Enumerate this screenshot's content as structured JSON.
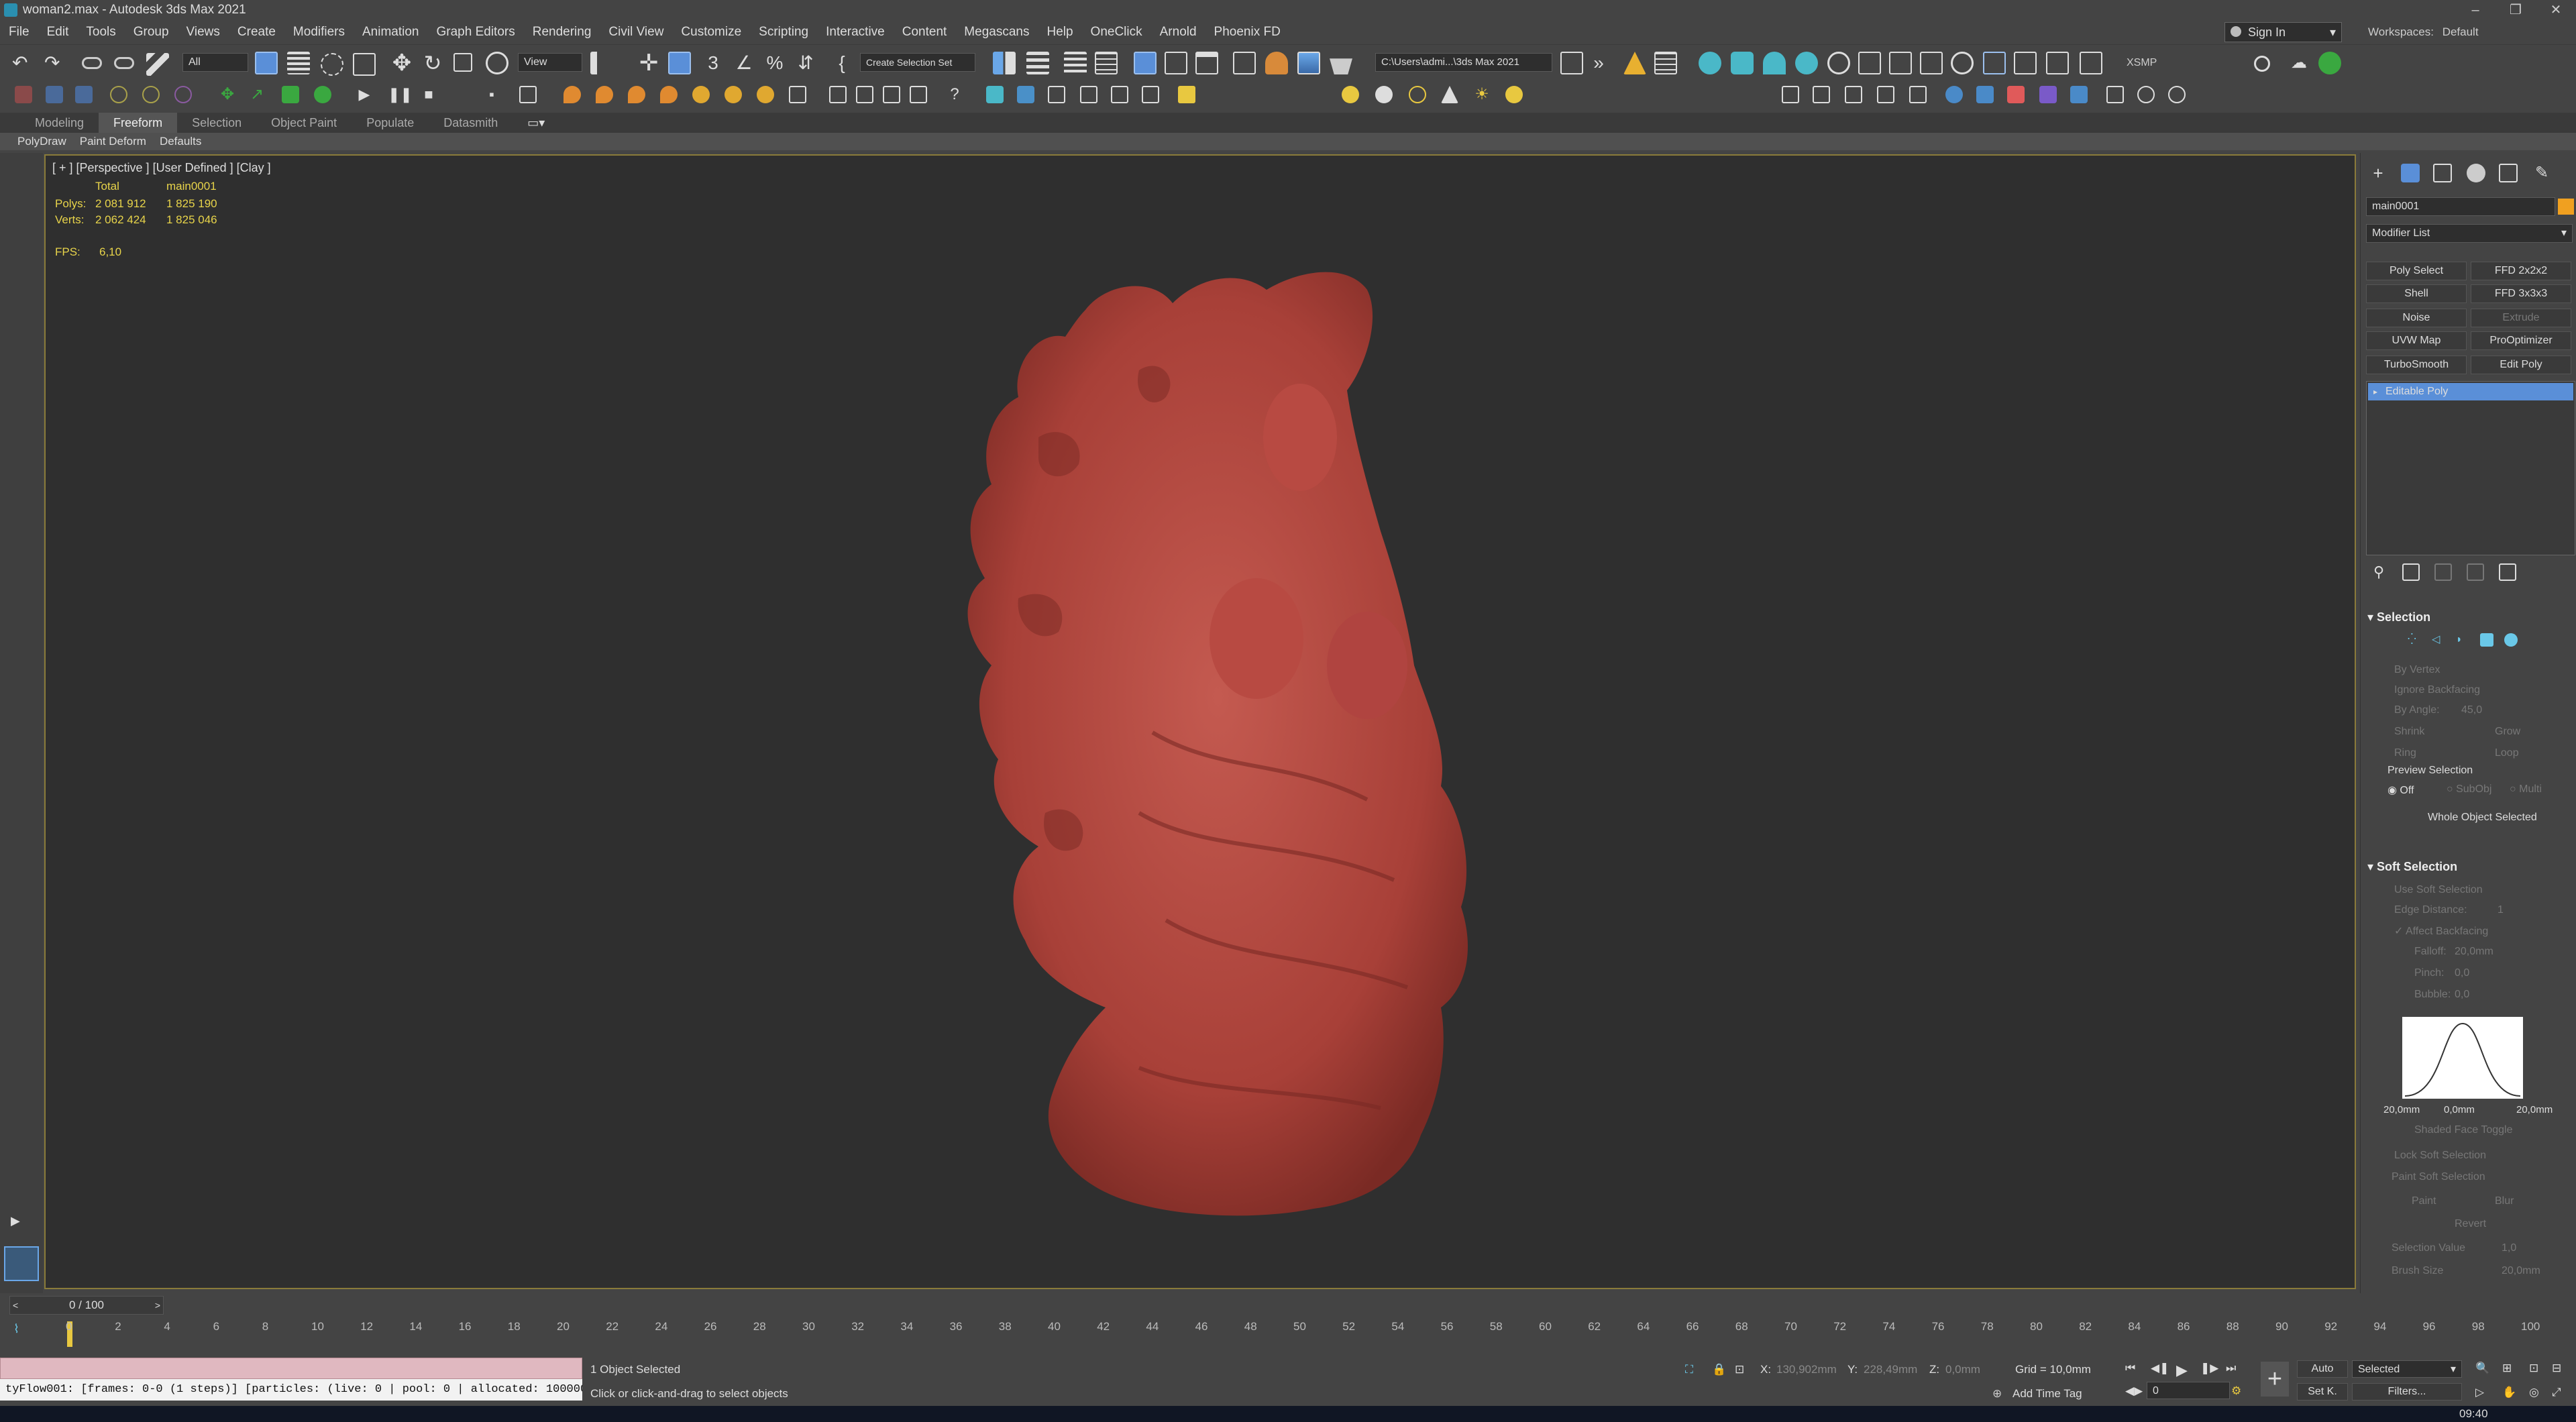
{
  "window": {
    "title": "woman2.max - Autodesk 3ds Max 2021",
    "minimize": "–",
    "restore": "❐",
    "close": "✕"
  },
  "menu": [
    "File",
    "Edit",
    "Tools",
    "Group",
    "Views",
    "Create",
    "Modifiers",
    "Animation",
    "Graph Editors",
    "Rendering",
    "Civil View",
    "Customize",
    "Scripting",
    "Interactive",
    "Content",
    "Megascans",
    "Help",
    "OneClick",
    "Arnold",
    "Phoenix FD"
  ],
  "account": {
    "signin": "Sign In",
    "workspaces_label": "Workspaces:",
    "workspace": "Default"
  },
  "toolbar": {
    "selection_filter": "All",
    "ref_coord": "View",
    "selection_set": "Create Selection Set",
    "project_path": "C:\\Users\\admi...\\3ds Max 2021",
    "xsmp": "XSMP"
  },
  "ribbon": {
    "tabs": [
      "Modeling",
      "Freeform",
      "Selection",
      "Object Paint",
      "Populate",
      "Datasmith"
    ],
    "active_tab": "Freeform",
    "subtabs": [
      "PolyDraw",
      "Paint Deform",
      "Defaults"
    ]
  },
  "viewport": {
    "label": "[ + ] [Perspective ] [User Defined ] [Clay ]",
    "stats": {
      "col_total": "Total",
      "col_obj": "main0001",
      "polys_label": "Polys:",
      "polys_total": "2 081 912",
      "polys_obj": "1 825 190",
      "verts_label": "Verts:",
      "verts_total": "2 062 424",
      "verts_obj": "1 825 046",
      "fps_label": "FPS:",
      "fps": "6,10"
    },
    "model_color": "#b5453e"
  },
  "command_panel": {
    "object_name": "main0001",
    "object_color": "#f0a020",
    "modifier_list": "Modifier List",
    "modifier_buttons": [
      [
        "Poly Select",
        "FFD 2x2x2"
      ],
      [
        "Shell",
        "FFD 3x3x3"
      ],
      [
        "Noise",
        "Extrude"
      ],
      [
        "UVW Map",
        "ProOptimizer"
      ],
      [
        "TurboSmooth",
        "Edit Poly"
      ]
    ],
    "stack_item": "Editable Poly",
    "selection": {
      "title": "Selection",
      "by_vertex": "By Vertex",
      "ignore_backfacing": "Ignore Backfacing",
      "by_angle": "By Angle:",
      "by_angle_val": "45,0",
      "shrink": "Shrink",
      "grow": "Grow",
      "ring": "Ring",
      "loop": "Loop",
      "preview": "Preview Selection",
      "off": "Off",
      "subobj": "SubObj",
      "multi": "Multi",
      "status": "Whole Object Selected"
    },
    "soft_selection": {
      "title": "Soft Selection",
      "use_soft": "Use Soft Selection",
      "edge_distance": "Edge Distance:",
      "edge_val": "1",
      "affect_backfacing": "Affect Backfacing",
      "falloff": "Falloff:",
      "falloff_val": "20,0mm",
      "pinch": "Pinch:",
      "pinch_val": "0,0",
      "bubble": "Bubble:",
      "bubble_val": "0,0",
      "curve_left": "20,0mm",
      "curve_mid": "0,0mm",
      "curve_right": "20,0mm",
      "shaded_face": "Shaded Face Toggle",
      "lock_soft": "Lock Soft Selection",
      "paint_soft": "Paint Soft Selection",
      "paint": "Paint",
      "blur": "Blur",
      "revert": "Revert",
      "selection_value": "Selection Value",
      "selection_value_val": "1,0",
      "brush_size": "Brush Size",
      "brush_size_val": "20,0mm"
    }
  },
  "timeline": {
    "slider": "0 / 100",
    "ticks": [
      "0",
      "2",
      "4",
      "6",
      "8",
      "10",
      "12",
      "14",
      "16",
      "18",
      "20",
      "22",
      "24",
      "26",
      "28",
      "30",
      "32",
      "34",
      "36",
      "38",
      "40",
      "42",
      "44",
      "46",
      "48",
      "50",
      "52",
      "54",
      "56",
      "58",
      "60",
      "62",
      "64",
      "66",
      "68",
      "70",
      "72",
      "74",
      "76",
      "78",
      "80",
      "82",
      "84",
      "86",
      "88",
      "90",
      "92",
      "94",
      "96",
      "98",
      "100"
    ]
  },
  "status": {
    "maxscript_output": "tyFlow001: [frames: 0-0 (1 steps)] [particles: (live: 0 | pool: 0 | allocated: 100000",
    "selected_count": "1 Object Selected",
    "prompt": "Click or click-and-drag to select objects",
    "x_label": "X:",
    "x_val": "130,902mm",
    "y_label": "Y:",
    "y_val": "228,49mm",
    "z_label": "Z:",
    "z_val": "0,0mm",
    "grid": "Grid = 10,0mm",
    "add_time_tag": "Add Time Tag",
    "auto": "Auto",
    "set_key": "Set K.",
    "key_filter": "Selected",
    "filters": "Filters...",
    "frame": "0",
    "clock": "09:40"
  }
}
